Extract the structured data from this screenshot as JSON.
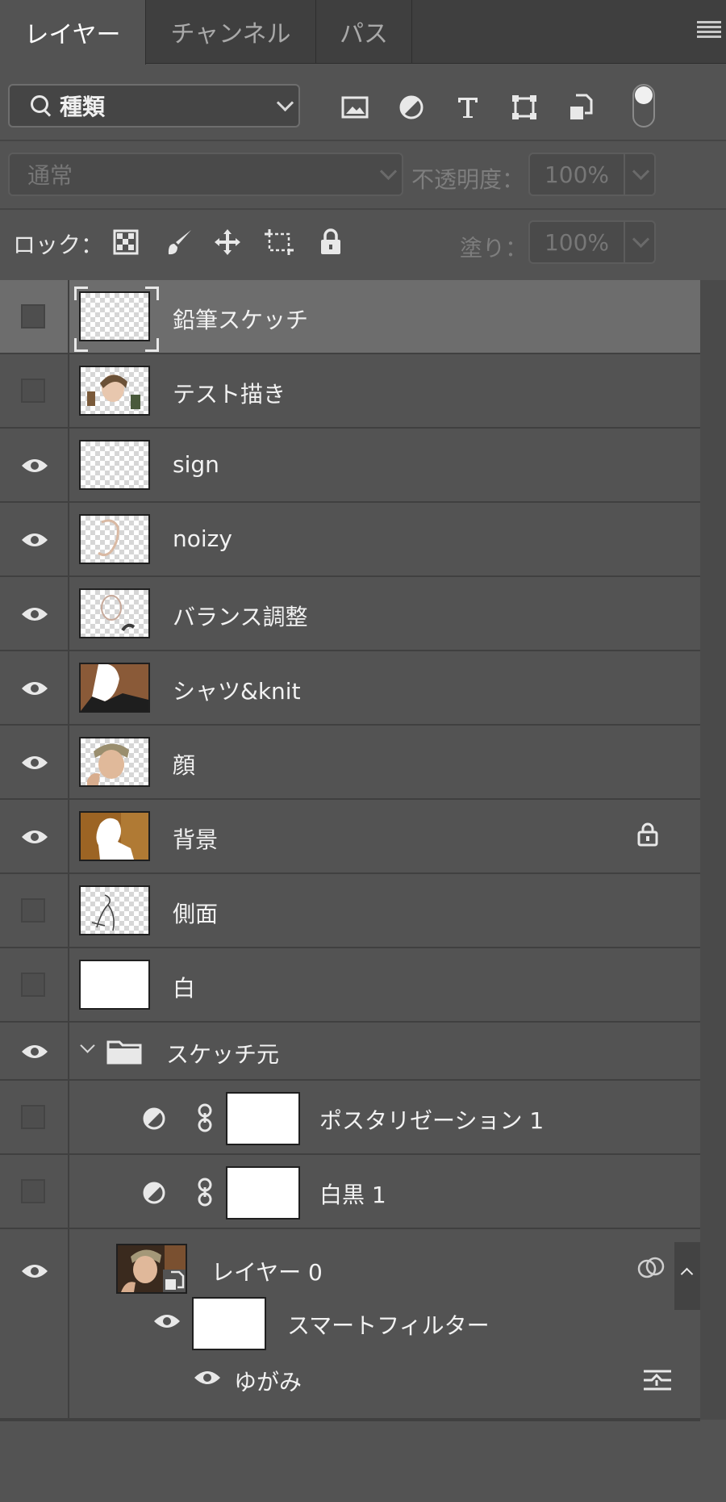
{
  "tabs": [
    {
      "label": "レイヤー",
      "active": true
    },
    {
      "label": "チャンネル",
      "active": false
    },
    {
      "label": "パス",
      "active": false
    }
  ],
  "filter": {
    "kind_label": "種類",
    "icons": [
      "image-filter-icon",
      "adjustment-filter-icon",
      "type-filter-icon",
      "shape-filter-icon",
      "smart-object-filter-icon"
    ]
  },
  "blend": {
    "mode": "通常",
    "opacity_label": "不透明度：",
    "opacity_value": "100%"
  },
  "lock": {
    "label": "ロック：",
    "fill_label": "塗り：",
    "fill_value": "100%",
    "icons": [
      "lock-transparent-icon",
      "lock-paint-icon",
      "lock-position-icon",
      "lock-artboard-icon",
      "lock-all-icon"
    ]
  },
  "layers": [
    {
      "name": "鉛筆スケッチ",
      "visible": false,
      "selected": true
    },
    {
      "name": "テスト描き",
      "visible": false
    },
    {
      "name": "sign",
      "visible": true
    },
    {
      "name": "noizy",
      "visible": true
    },
    {
      "name": "バランス調整",
      "visible": true
    },
    {
      "name": "シャツ&knit",
      "visible": true
    },
    {
      "name": "顔",
      "visible": true
    },
    {
      "name": "背景",
      "visible": true,
      "locked": true
    },
    {
      "name": "側面",
      "visible": false
    },
    {
      "name": "白",
      "visible": false
    },
    {
      "name": "スケッチ元",
      "visible": true,
      "group": true
    },
    {
      "name": "ポスタリゼーション 1",
      "visible": false,
      "adjustment": true
    },
    {
      "name": "白黒 1",
      "visible": false,
      "adjustment": true
    },
    {
      "name": "レイヤー 0",
      "visible": true,
      "smart_object": true
    },
    {
      "name": "スマートフィルター",
      "visible": true
    },
    {
      "name": "ゆがみ",
      "visible": true
    }
  ]
}
